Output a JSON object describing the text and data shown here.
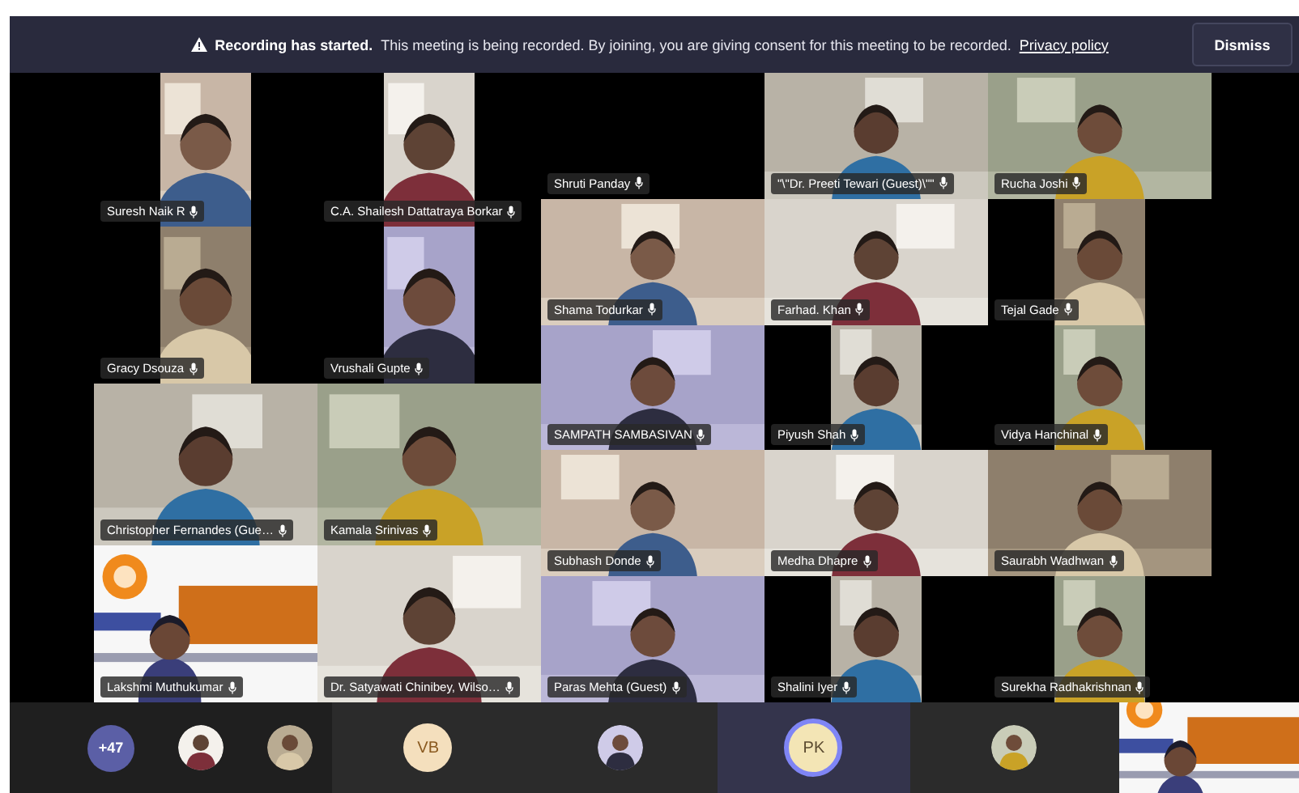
{
  "banner": {
    "title": "Recording has started.",
    "message": "This meeting is being recorded. By joining, you are giving consent for this meeting to be recorded.",
    "link": "Privacy policy",
    "button": "Dismiss"
  },
  "left_grid": [
    {
      "name": "Suresh Naik R",
      "kind": "portrait"
    },
    {
      "name": "C.A. Shailesh Dattatraya Borkar",
      "kind": "portrait"
    },
    {
      "name": "Gracy Dsouza",
      "kind": "portrait"
    },
    {
      "name": "Vrushali Gupte",
      "kind": "portrait"
    },
    {
      "name": "Christopher Fernandes (Gue…",
      "kind": "video"
    },
    {
      "name": "Kamala Srinivas",
      "kind": "video"
    },
    {
      "name": "Lakshmi Muthukumar",
      "kind": "banner"
    },
    {
      "name": "Dr. Satyawati Chinibey, Wilso…",
      "kind": "video"
    }
  ],
  "right_grid": [
    {
      "name": "Shruti Panday",
      "kind": "off"
    },
    {
      "name": "\"\\\"Dr. Preeti Tewari (Guest)\\\"\"",
      "kind": "video"
    },
    {
      "name": "Rucha Joshi",
      "kind": "video"
    },
    {
      "name": "Shama Todurkar",
      "kind": "video"
    },
    {
      "name": "Farhad. Khan",
      "kind": "video"
    },
    {
      "name": "Tejal Gade",
      "kind": "portrait"
    },
    {
      "name": "SAMPATH SAMBASIVAN",
      "kind": "video"
    },
    {
      "name": "Piyush Shah",
      "kind": "portrait"
    },
    {
      "name": "Vidya Hanchinal",
      "kind": "portrait"
    },
    {
      "name": "Subhash Donde",
      "kind": "video"
    },
    {
      "name": "Medha Dhapre",
      "kind": "video"
    },
    {
      "name": "Saurabh Wadhwan",
      "kind": "video"
    },
    {
      "name": "Paras Mehta (Guest)",
      "kind": "video"
    },
    {
      "name": "Shalini Iyer",
      "kind": "portrait"
    },
    {
      "name": "Surekha Radhakrishnan",
      "kind": "portrait"
    }
  ],
  "roster": {
    "count": "+47",
    "avatars": [
      {
        "kind": "avatar"
      },
      {
        "kind": "avatar"
      }
    ]
  },
  "strip": [
    {
      "kind": "initials",
      "text": "VB",
      "speaking": false
    },
    {
      "kind": "avatar",
      "speaking": false
    },
    {
      "kind": "initials",
      "text": "PK",
      "speaking": true
    },
    {
      "kind": "avatar",
      "speaking": false
    },
    {
      "kind": "video",
      "speaking": false
    }
  ]
}
